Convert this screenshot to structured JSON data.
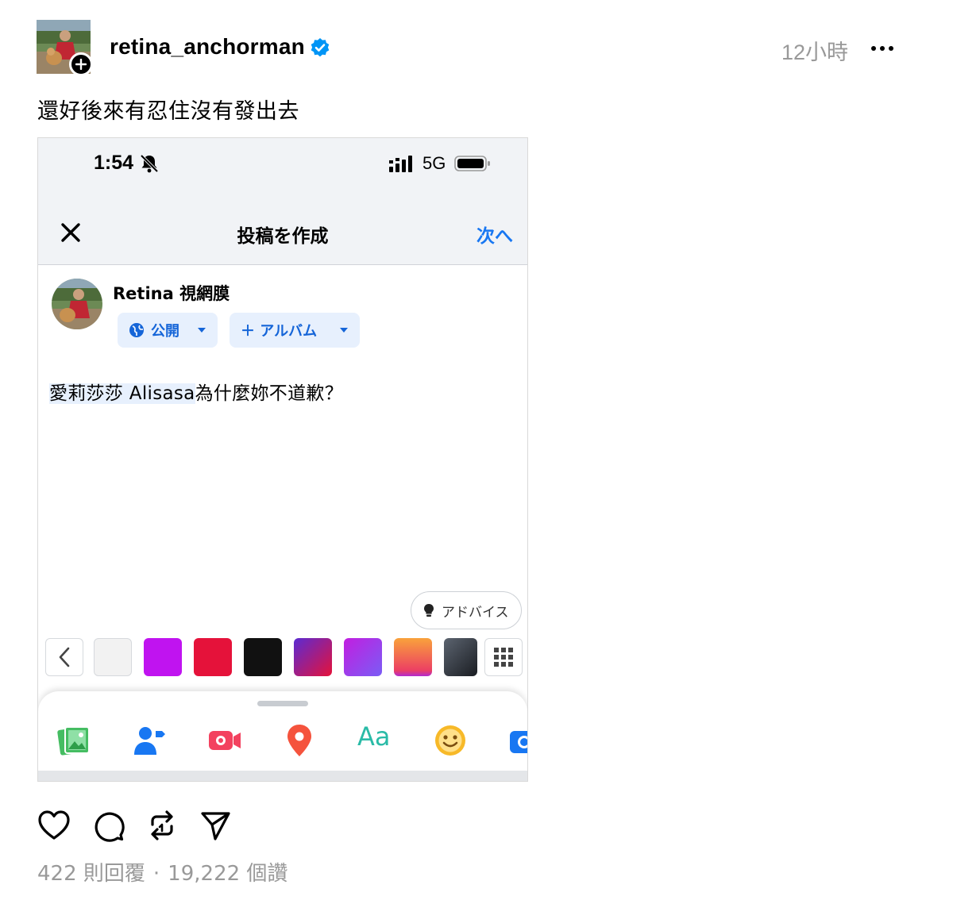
{
  "post": {
    "username": "retina_anchorman",
    "timestamp": "12小時",
    "caption": "還好後來有忍住沒有發出去",
    "replies": "422 則回覆",
    "separator": "·",
    "likes": "19,222 個讚"
  },
  "screenshot": {
    "status_time": "1:54",
    "network": "5G",
    "nav_title": "投稿を作成",
    "nav_next": "次へ",
    "author_name": "Retina 視網膜",
    "privacy_label": "公開",
    "album_label": "＋ アルバム",
    "mention": "愛莉莎莎 Alisasa",
    "post_text_rest": "為什麼妳不道歉？",
    "advice_label": "アドバイス",
    "aa_label": "Aa",
    "swatch_colors": [
      "#f2f2f2",
      "#c013f0",
      "#e5123a",
      "#111111",
      "gradient-purple-red",
      "gradient-violet",
      "gradient-orange-pink",
      "gradient-slate"
    ],
    "toolbar_icons": [
      "photo-icon",
      "tag-people-icon",
      "live-video-icon",
      "location-pin-icon",
      "text-style-icon",
      "feeling-emoji-icon",
      "camera-icon"
    ]
  },
  "colors": {
    "facebook_blue": "#1877f2",
    "verified_blue": "#0095f6",
    "muted_gray": "#999999"
  }
}
